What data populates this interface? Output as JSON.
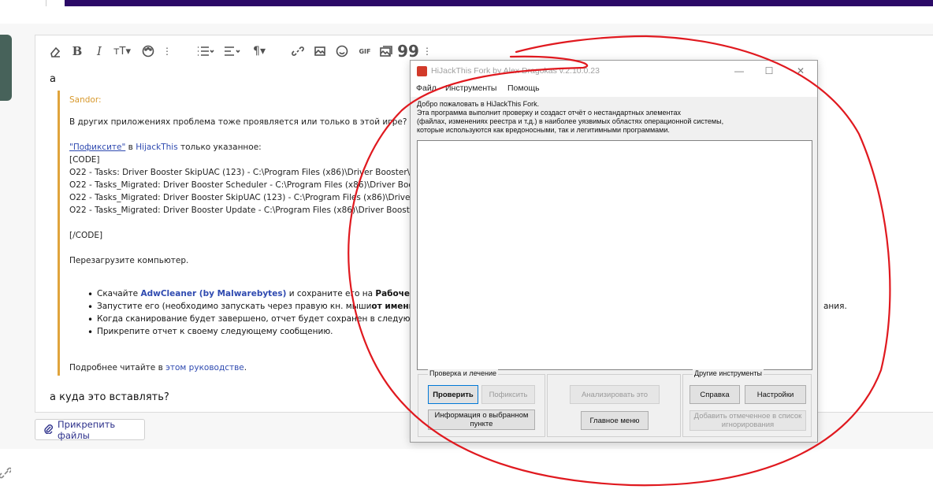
{
  "editor": {
    "first_line": "а",
    "quote": {
      "author": "Sandor:",
      "question": "В других приложениях проблема тоже проявляется или только в этой игре?",
      "fix_link": "\"Пофиксите\"",
      "fix_in": "в",
      "hjt_link": "HijackThis",
      "fix_rest": "только указанное:",
      "code_open": "[CODE]",
      "code_lines": [
        "O22 - Tasks: Driver Booster SkipUAC (123) - C:\\Program Files (x86)\\Driver Booster\\DriverB",
        "O22 - Tasks_Migrated: Driver Booster Scheduler - C:\\Program Files (x86)\\Driver Booster\\S",
        "O22 - Tasks_Migrated: Driver Booster SkipUAC (123) - C:\\Program Files (x86)\\Driver Boost",
        "O22 - Tasks_Migrated: Driver Booster Update - C:\\Program Files (x86)\\Driver Booster\\Aut"
      ],
      "code_close": "[/CODE]",
      "reboot": "Перезагрузите компьютер.",
      "b1_pre": "Скачайте",
      "b1_link": "AdwCleaner (by Malwarebytes)",
      "b1_mid": "и сохраните его на",
      "b1_bold": "Рабочем столе.",
      "b2_pre": "Запустите его (необходимо запускать через правую кн. мыши",
      "b2_bold": "от имени адми",
      "b2_tail": "ания.",
      "b3": "Когда сканирование будет завершено, отчет будет сохранен в следующем рас",
      "b4": "Прикрепите отчет к своему следующему сообщению.",
      "more_pre": "Подробнее читайте в",
      "more_link": "этом руководстве",
      "more_dot": "."
    },
    "reply": "а куда это вставлять?",
    "attach_label": "Прикрепить файлы",
    "toolbar_icons": [
      "eraser-icon",
      "bold-icon",
      "italic-icon",
      "text-size-icon",
      "palette-icon",
      "more-icon",
      "list-icon",
      "align-icon",
      "paragraph-icon",
      "link-icon",
      "image-icon",
      "smile-icon",
      "gif-icon",
      "media-icon",
      "quote-icon",
      "more-icon"
    ]
  },
  "hjt": {
    "title": "HiJackThis Fork by Alex Dragokas v.2.10.0.23",
    "menu": [
      "Файл",
      "Инструменты",
      "Помощь"
    ],
    "intro": [
      "Добро пожаловать в HiJackThis Fork.",
      "Эта программа выполнит проверку и создаст отчёт о нестандартных элементах",
      "(файлах, изменениях реестра и т.д.) в наиболее уязвимых областях операционной системы,",
      "которые используются как вредоносными, так и легитимными программами."
    ],
    "group_scan": "Проверка и лечение",
    "group_other": "Другие инструменты",
    "btn_scan": "Проверить",
    "btn_fix": "Пофиксить",
    "btn_info": "Информация о выбранном пункте",
    "btn_analyze": "Анализировать это",
    "btn_main": "Главное меню",
    "btn_help": "Справка",
    "btn_settings": "Настройки",
    "btn_ignore": "Добавить отмеченное в список игнорирования"
  },
  "colors": {
    "accent_purple": "#2b0a67",
    "quote_bar": "#e0a43c",
    "annotation_red": "#e0191f"
  }
}
